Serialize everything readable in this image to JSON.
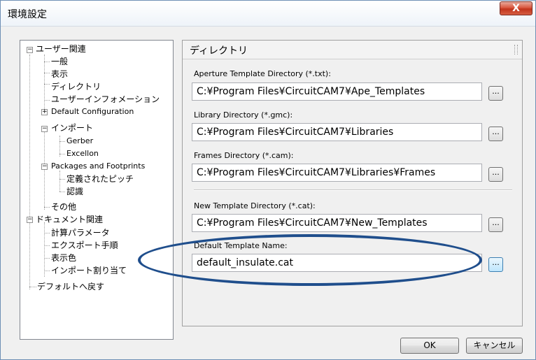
{
  "window": {
    "title": "環境設定",
    "close_icon": "close-icon",
    "close_label": "X"
  },
  "tree": {
    "items": [
      {
        "label": "ユーザー関連",
        "expander": "−"
      },
      {
        "label": "一般"
      },
      {
        "label": "表示"
      },
      {
        "label": "ディレクトリ"
      },
      {
        "label": "ユーザーインフォメーション"
      },
      {
        "label": "Default Configuration",
        "expander": "+"
      },
      {
        "label": "インポート",
        "expander": "−"
      },
      {
        "label": "Gerber"
      },
      {
        "label": "Excellon"
      },
      {
        "label": "Packages and Footprints",
        "expander": "−"
      },
      {
        "label": "定義されたピッチ"
      },
      {
        "label": "認識"
      },
      {
        "label": "その他"
      },
      {
        "label": "ドキュメント関連",
        "expander": "−"
      },
      {
        "label": "計算パラメータ"
      },
      {
        "label": "エクスポート手順"
      },
      {
        "label": "表示色"
      },
      {
        "label": "インポート割り当て"
      },
      {
        "label": "デフォルトへ戻す"
      }
    ]
  },
  "panel": {
    "title": "ディレクトリ",
    "fields": [
      {
        "label": "Aperture Template Directory (*.txt):",
        "value": "C:¥Program Files¥CircuitCAM7¥Ape_Templates"
      },
      {
        "label": "Library  Directory (*.gmc):",
        "value": "C:¥Program Files¥CircuitCAM7¥Libraries"
      },
      {
        "label": "Frames Directory (*.cam):",
        "value": "C:¥Program Files¥CircuitCAM7¥Libraries¥Frames"
      },
      {
        "label": "New Template Directory (*.cat):",
        "value": "C:¥Program Files¥CircuitCAM7¥New_Templates"
      },
      {
        "label": "Default Template Name:",
        "value": "default_insulate.cat"
      }
    ],
    "browse_label": "..."
  },
  "buttons": {
    "ok": "OK",
    "cancel": "キャンセル"
  },
  "colors": {
    "highlight_ellipse": "#1f4e8c",
    "close_button": "#c1341c"
  }
}
